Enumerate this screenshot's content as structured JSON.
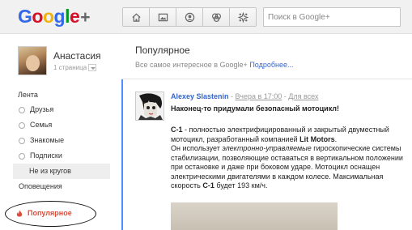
{
  "header": {
    "logo_text": "Google+",
    "nav_icons": [
      "home-icon",
      "photos-icon",
      "profile-icon",
      "circles-icon",
      "games-icon"
    ],
    "search_placeholder": "Поиск в Google+"
  },
  "sidebar": {
    "user_name": "Анастасия",
    "user_page": "1 страница",
    "section_label": "Лента",
    "items": [
      {
        "label": "Друзья"
      },
      {
        "label": "Семья"
      },
      {
        "label": "Знакомые"
      },
      {
        "label": "Подписки"
      },
      {
        "label": "Не из кругов"
      },
      {
        "label": "Оповещения"
      }
    ],
    "popular_label": "Популярное"
  },
  "main": {
    "title": "Популярное",
    "subtitle": "Все самое интересное в Google+",
    "more_link": "Подробнее...",
    "post": {
      "author": "Alexey Slastenin",
      "time": "Вчера в 17:00",
      "audience": "Для всех",
      "separator": " - ",
      "title": "Наконец-то придумали безопасный мотоцикл!",
      "p1_a": "С-1",
      "p1_b": " - полностью электрифицированный и закрытый двуместный мотоцикл, разработанный компанией ",
      "p1_c": "Lit Motors",
      "p1_d": ".",
      "p2_a": "Он использует ",
      "p2_b": "электронно-управляемые",
      "p2_c": " гироскопические системы стабилизации, позволяющие оставаться в вертикальном положении при остановке и даже при боковом ударе. Мотоцикл оснащен электрическими двигателями в каждом колесе. Максимальная скорость ",
      "p2_d": "С-1",
      "p2_e": " будет 193 км/ч."
    }
  },
  "colors": {
    "accent": "#4d90fe",
    "link": "#3366cc",
    "popular": "#dd4b39"
  }
}
